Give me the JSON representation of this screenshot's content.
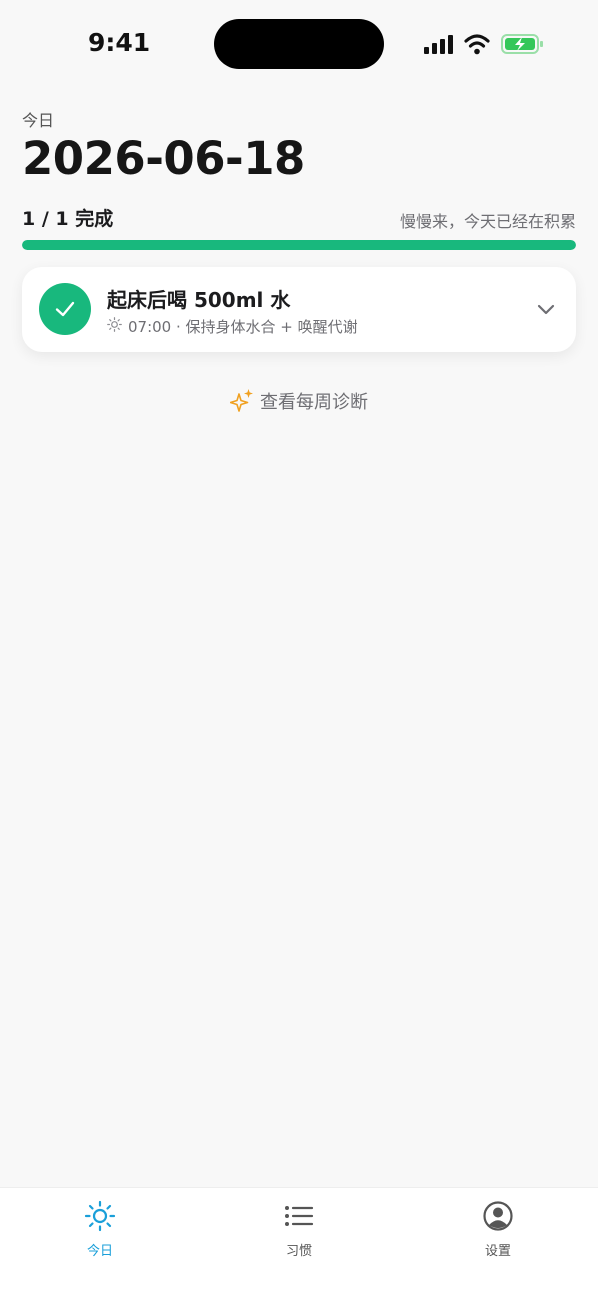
{
  "status_bar": {
    "time": "9:41",
    "icons": [
      "signal-icon",
      "wifi-icon",
      "battery-charging-icon"
    ]
  },
  "header": {
    "day_label": "今日",
    "date": "2026-06-18"
  },
  "progress": {
    "text": "1 / 1 完成",
    "message": "慢慢来，今天已经在积累",
    "completed": 1,
    "total": 1
  },
  "habits": [
    {
      "title": "起床后喝 500ml 水",
      "icon": "sun-icon",
      "subtitle": "07:00 · 保持身体水合 + 唤醒代谢",
      "done": true
    }
  ],
  "diagnose": {
    "label": "查看每周诊断",
    "icon": "sparkles-icon"
  },
  "tabbar": {
    "tabs": [
      {
        "label": "今日",
        "icon": "sun-icon",
        "active": true
      },
      {
        "label": "习惯",
        "icon": "list-icon",
        "active": false
      },
      {
        "label": "设置",
        "icon": "person-circle-icon",
        "active": false
      }
    ]
  },
  "colors": {
    "accent_green": "#18b87d",
    "active_tab": "#1a9fd9",
    "sparkle": "#f0a020"
  }
}
